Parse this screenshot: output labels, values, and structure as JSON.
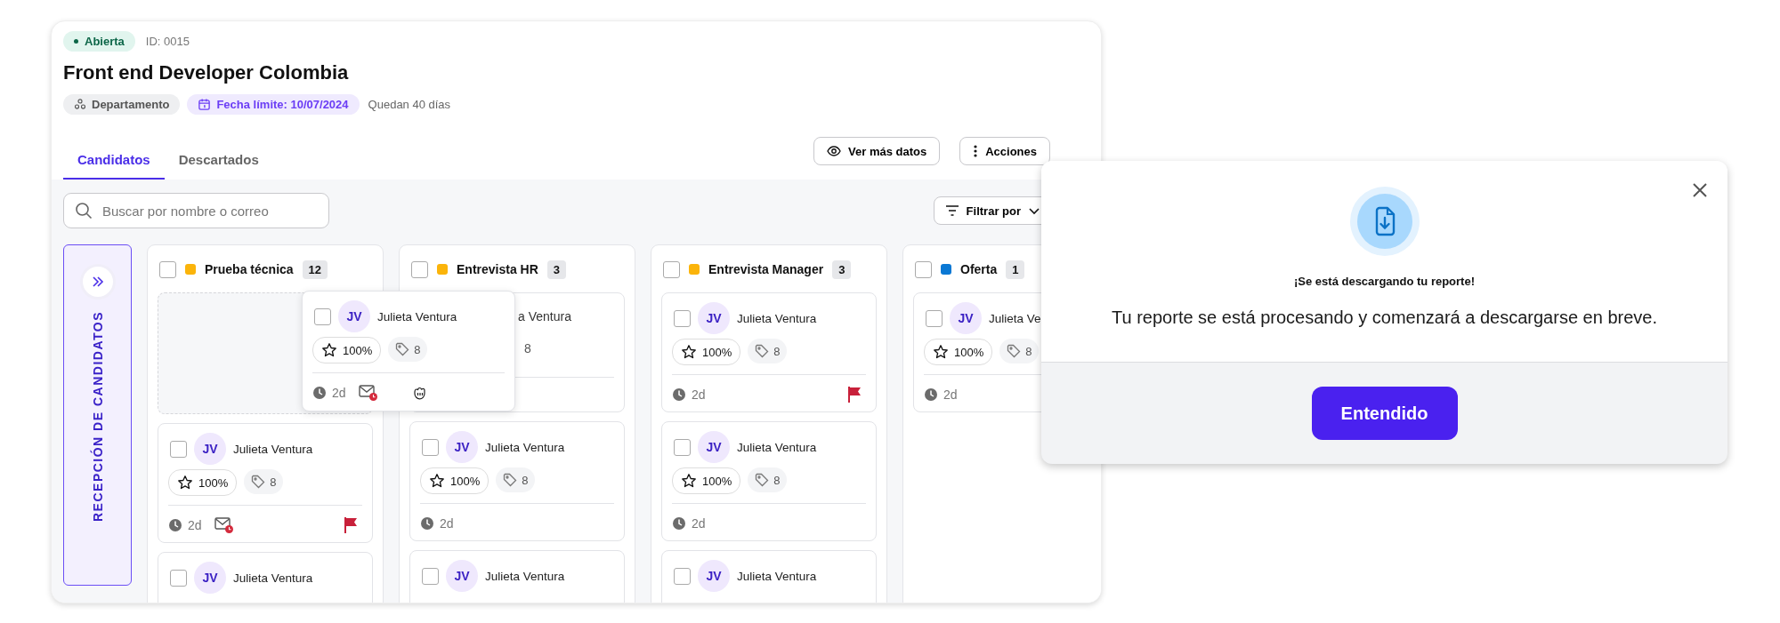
{
  "status_badge": {
    "label": "Abierta"
  },
  "job_id": "ID: 0015",
  "title": "Front end Developer Colombia",
  "chips": [
    {
      "kind": "department",
      "label": "Departamento"
    },
    {
      "kind": "deadline",
      "label": "Fecha límite: 10/07/2024"
    }
  ],
  "remaining": "Quedan 40 días",
  "tabs": [
    {
      "label": "Candidatos",
      "selected": true
    },
    {
      "label": "Descartados",
      "selected": false
    }
  ],
  "actions": [
    {
      "kind": "view",
      "label": "Ver más datos"
    },
    {
      "kind": "more",
      "label": "Acciones"
    }
  ],
  "search": {
    "placeholder": "Buscar por nombre o correo"
  },
  "filter": {
    "label": "Filtrar por"
  },
  "collapsed_column": {
    "label": "RECEPCIÓN DE CANDIDATOS"
  },
  "columns": [
    {
      "name": "Prueba técnica",
      "color": "#fbb40a",
      "count": "12",
      "checked": false,
      "cards": [
        {
          "kind": "placeholder"
        },
        {
          "kind": "full",
          "checked": false,
          "initials": "JV",
          "name": "Julieta Ventura",
          "score": "100%",
          "tags": "8",
          "time": "2d",
          "mail_alert": true,
          "flagged": true
        },
        {
          "kind": "cut",
          "checked": false,
          "initials": "JV",
          "name": "Julieta Ventura"
        }
      ]
    },
    {
      "name": "Entrevista HR",
      "color": "#fbb40a",
      "count": "3",
      "checked": false,
      "cards": [
        {
          "kind": "covered",
          "name": "a Ventura",
          "tags": "8"
        },
        {
          "kind": "full",
          "checked": false,
          "initials": "JV",
          "name": "Julieta Ventura",
          "score": "100%",
          "tags": "8",
          "time": "2d",
          "mail_alert": false,
          "flagged": false
        },
        {
          "kind": "cut",
          "checked": false,
          "initials": "JV",
          "name": "Julieta Ventura"
        }
      ]
    },
    {
      "name": "Entrevista Manager",
      "color": "#fbb40a",
      "count": "3",
      "checked": false,
      "cards": [
        {
          "kind": "full",
          "checked": false,
          "initials": "JV",
          "name": "Julieta Ventura",
          "score": "100%",
          "tags": "8",
          "time": "2d",
          "mail_alert": false,
          "flagged": true
        },
        {
          "kind": "full",
          "checked": false,
          "initials": "JV",
          "name": "Julieta Ventura",
          "score": "100%",
          "tags": "8",
          "time": "2d",
          "mail_alert": false,
          "flagged": false
        },
        {
          "kind": "cut",
          "checked": false,
          "initials": "JV",
          "name": "Julieta Ventura"
        }
      ]
    },
    {
      "name": "Oferta",
      "color": "#0a78d4",
      "count": "1",
      "checked": false,
      "cards": [
        {
          "kind": "full",
          "checked": false,
          "initials": "JV",
          "name": "Julieta Ve",
          "score": "100%",
          "tags": "8",
          "time": "2d",
          "mail_alert": false,
          "flagged": false
        }
      ]
    }
  ],
  "dragged_card": {
    "checked": false,
    "initials": "JV",
    "name": "Julieta Ventura",
    "score": "100%",
    "tags": "8",
    "time": "2d",
    "mail_alert": true,
    "flagged": false
  },
  "modal": {
    "title": "¡Se está descargando tu reporte!",
    "message": "Tu reporte se está procesando y comenzará a descargarse en breve.",
    "button": "Entendido"
  }
}
